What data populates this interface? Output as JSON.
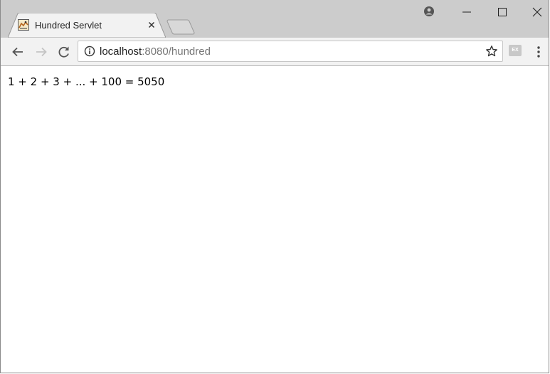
{
  "tab": {
    "title": "Hundred Servlet"
  },
  "address_bar": {
    "host": "localhost",
    "rest": ":8080/hundred"
  },
  "extension": {
    "label": "EX"
  },
  "page": {
    "text": "1 + 2 + 3 + ... + 100 = 5050"
  },
  "colors": {
    "tabstrip": "#cccccc",
    "toolbar": "#f2f2f2",
    "url_host": "#222222",
    "url_rest": "#777777"
  }
}
